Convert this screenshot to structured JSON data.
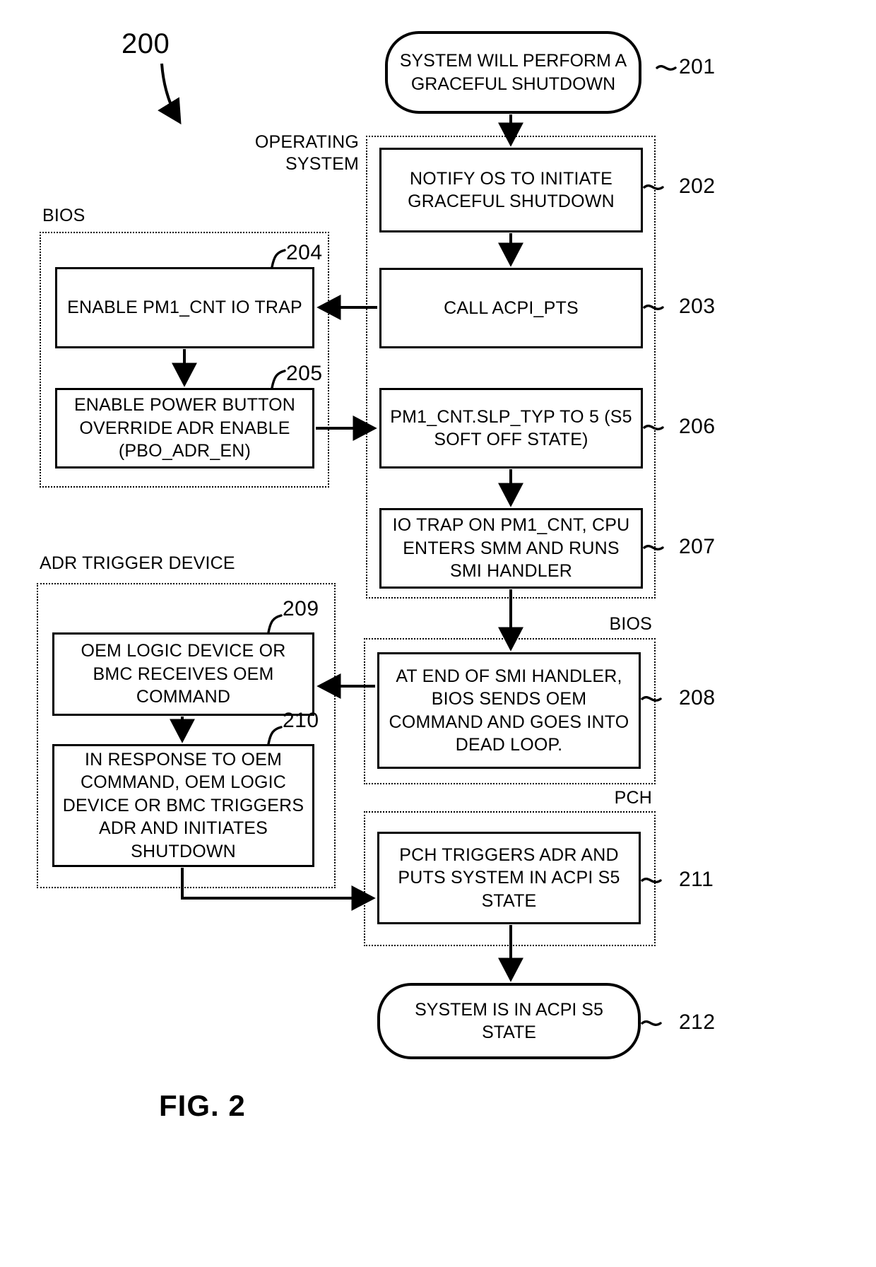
{
  "figure": {
    "caption": "FIG. 2",
    "diagram_number": "200"
  },
  "groups": [
    {
      "id": "operating-system",
      "label": "OPERATING\nSYSTEM"
    },
    {
      "id": "bios-left",
      "label": "BIOS"
    },
    {
      "id": "adr-trigger",
      "label": "ADR TRIGGER DEVICE"
    },
    {
      "id": "bios-right",
      "label": "BIOS"
    },
    {
      "id": "pch",
      "label": "PCH"
    }
  ],
  "nodes": [
    {
      "id": "n201",
      "ref": "201",
      "shape": "terminator",
      "text": "SYSTEM WILL PERFORM A GRACEFUL SHUTDOWN"
    },
    {
      "id": "n202",
      "ref": "202",
      "shape": "process",
      "text": "NOTIFY OS TO INITIATE GRACEFUL SHUTDOWN"
    },
    {
      "id": "n203",
      "ref": "203",
      "shape": "process",
      "text": "CALL ACPI_PTS"
    },
    {
      "id": "n204",
      "ref": "204",
      "shape": "process",
      "text": "ENABLE PM1_CNT IO TRAP"
    },
    {
      "id": "n205",
      "ref": "205",
      "shape": "process",
      "text": "ENABLE POWER BUTTON OVERRIDE ADR ENABLE (PBO_ADR_EN)"
    },
    {
      "id": "n206",
      "ref": "206",
      "shape": "process",
      "text": "PM1_CNT.SLP_TYP TO 5 (S5 SOFT OFF STATE)"
    },
    {
      "id": "n207",
      "ref": "207",
      "shape": "process",
      "text": "IO TRAP ON PM1_CNT, CPU ENTERS SMM AND RUNS SMI HANDLER"
    },
    {
      "id": "n208",
      "ref": "208",
      "shape": "process",
      "text": "AT END OF SMI HANDLER, BIOS SENDS OEM COMMAND AND GOES INTO DEAD LOOP."
    },
    {
      "id": "n209",
      "ref": "209",
      "shape": "process",
      "text": "OEM LOGIC DEVICE OR BMC RECEIVES OEM COMMAND"
    },
    {
      "id": "n210",
      "ref": "210",
      "shape": "process",
      "text": "IN RESPONSE TO OEM COMMAND, OEM LOGIC DEVICE OR BMC TRIGGERS ADR AND INITIATES SHUTDOWN"
    },
    {
      "id": "n211",
      "ref": "211",
      "shape": "process",
      "text": "PCH TRIGGERS ADR AND PUTS SYSTEM IN ACPI S5 STATE"
    },
    {
      "id": "n212",
      "ref": "212",
      "shape": "terminator",
      "text": "SYSTEM IS IN ACPI S5 STATE"
    }
  ],
  "edges": [
    {
      "from": "n201",
      "to": "n202",
      "direction": "down"
    },
    {
      "from": "n202",
      "to": "n203",
      "direction": "down"
    },
    {
      "from": "n203",
      "to": "n204",
      "direction": "left"
    },
    {
      "from": "n204",
      "to": "n205",
      "direction": "down"
    },
    {
      "from": "n205",
      "to": "n206",
      "direction": "right"
    },
    {
      "from": "n206",
      "to": "n207",
      "direction": "down"
    },
    {
      "from": "n207",
      "to": "n208",
      "direction": "down"
    },
    {
      "from": "n208",
      "to": "n209",
      "direction": "left"
    },
    {
      "from": "n209",
      "to": "n210",
      "direction": "down"
    },
    {
      "from": "n210",
      "to": "n211",
      "direction": "down-right"
    },
    {
      "from": "n211",
      "to": "n212",
      "direction": "down"
    }
  ]
}
